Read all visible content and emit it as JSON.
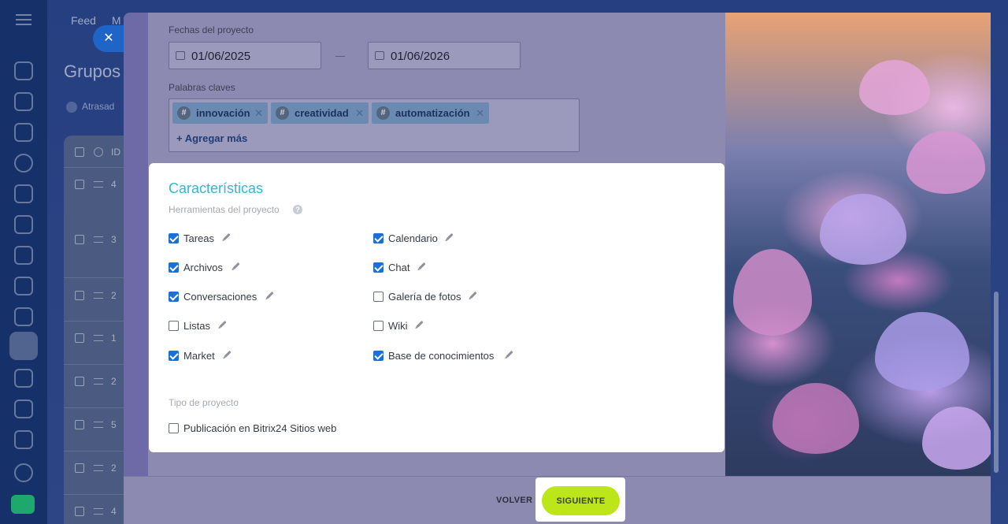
{
  "background": {
    "nav": [
      "Feed",
      "M"
    ],
    "heading": "Grupos",
    "filter_chip": "Atrasad",
    "table_header": "ID",
    "row_ids": [
      "4",
      "3",
      "2",
      "1",
      "2",
      "5",
      "2",
      "4"
    ]
  },
  "form": {
    "dates_label": "Fechas del proyecto",
    "start_date": "01/06/2025",
    "end_date": "01/06/2026",
    "keywords_label": "Palabras claves",
    "tags": [
      "innovación",
      "creatividad",
      "automatización"
    ],
    "add_more": "+ Agregar más"
  },
  "features": {
    "title": "Características",
    "tools_label": "Herramientas del proyecto",
    "tools": [
      {
        "label": "Tareas",
        "checked": true
      },
      {
        "label": "Calendario",
        "checked": true
      },
      {
        "label": "Archivos",
        "checked": true
      },
      {
        "label": "Chat",
        "checked": true
      },
      {
        "label": "Conversaciones",
        "checked": true
      },
      {
        "label": "Galería de fotos",
        "checked": false
      },
      {
        "label": "Listas",
        "checked": false
      },
      {
        "label": "Wiki",
        "checked": false
      },
      {
        "label": "Market",
        "checked": true
      },
      {
        "label": "Base de conocimientos",
        "checked": true
      }
    ],
    "type_label": "Tipo de proyecto",
    "type_option": {
      "label": "Publicación en Bitrix24 Sitios web",
      "checked": false
    }
  },
  "footer": {
    "back_label": "VOLVER",
    "next_label": "SIGUIENTE"
  },
  "colors": {
    "accent_title": "#2fb8d8",
    "checkbox_on": "#1c6fd8",
    "next_button": "#bde61a"
  },
  "icons": [
    "menu-icon",
    "close-icon",
    "calendar-icon",
    "hash-icon",
    "remove-tag-icon",
    "help-icon",
    "pencil-icon",
    "rocket-icon"
  ]
}
